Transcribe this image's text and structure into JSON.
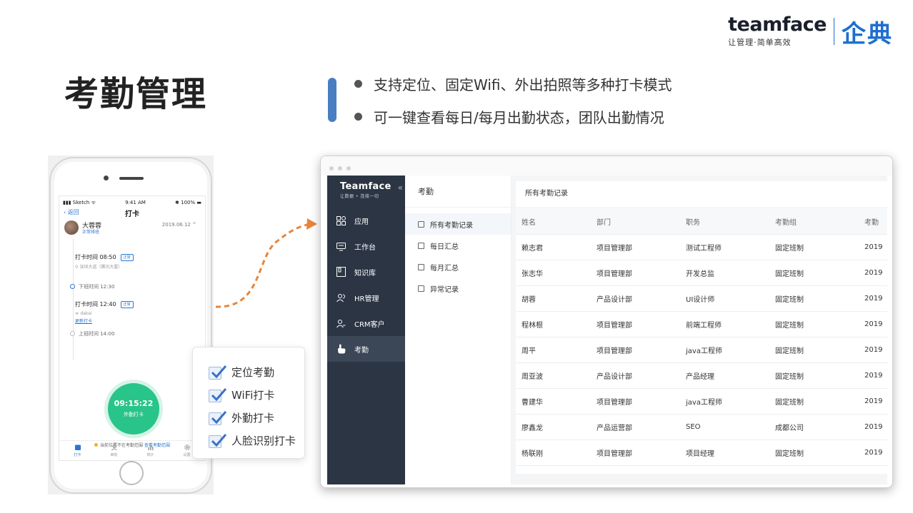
{
  "brand": {
    "word": "teamface",
    "tagline": "让管理·简单高效",
    "cn": "企典"
  },
  "slide": {
    "title": "考勤管理",
    "bullets": [
      "支持定位、固定Wifi、外出拍照等多种打卡模式",
      "可一键查看每日/每月出勤状态，团队出勤情况"
    ]
  },
  "phone": {
    "status": {
      "carrier": "Sketch",
      "time": "9:41 AM",
      "battery": "100%"
    },
    "nav": {
      "back": "返回",
      "title": "打卡"
    },
    "user": {
      "name": "大蓉蓉",
      "subtitle": "正常排班",
      "date": "2019.06.12"
    },
    "records": [
      {
        "time": "打卡时间 08:50",
        "badge": "正常",
        "sub": "深圳大道（腾讯大厦）"
      },
      {
        "node": "下班时间 12:30"
      },
      {
        "time": "打卡时间 12:40",
        "badge": "正常",
        "sub": "dakai",
        "link": "更新打卡"
      },
      {
        "node": "上班时间 14:00"
      }
    ],
    "clock": {
      "time": "09:15:22",
      "label": "外勤打卡"
    },
    "range_tip": {
      "text": "当前位置不在考勤范围",
      "link": "查看考勤范围"
    },
    "tabs": [
      "打卡",
      "审批",
      "统计",
      "设置"
    ]
  },
  "checklist": [
    "定位考勤",
    "WiFi打卡",
    "外勤打卡",
    "人脸识别打卡"
  ],
  "colors": {
    "accent": "#4a7ec2",
    "brand_blue": "#1e6fd0",
    "clock_green": "#29c48a",
    "sidebar": "#2b3544",
    "arrow": "#e8843a"
  },
  "app": {
    "logo": {
      "word": "Teamface",
      "tagline": "让数据 • 连接一切"
    },
    "sidebar": [
      "应用",
      "工作台",
      "知识库",
      "HR管理",
      "CRM客户",
      "考勤"
    ],
    "submenu": {
      "title": "考勤",
      "items": [
        "所有考勤记录",
        "每日汇总",
        "每月汇总",
        "异常记录"
      ]
    },
    "main_title": "所有考勤记录",
    "table": {
      "headers": [
        "姓名",
        "部门",
        "职务",
        "考勤组",
        "考勤"
      ],
      "rows": [
        [
          "赖志君",
          "项目管理部",
          "测试工程师",
          "固定班制",
          "2019"
        ],
        [
          "张志华",
          "项目管理部",
          "开发总监",
          "固定班制",
          "2019"
        ],
        [
          "胡蓉",
          "产品设计部",
          "UI设计师",
          "固定班制",
          "2019"
        ],
        [
          "程林根",
          "项目管理部",
          "前端工程师",
          "固定班制",
          "2019"
        ],
        [
          "周平",
          "项目管理部",
          "java工程师",
          "固定班制",
          "2019"
        ],
        [
          "周亚波",
          "产品设计部",
          "产品经理",
          "固定班制",
          "2019"
        ],
        [
          "曹建华",
          "项目管理部",
          "java工程师",
          "固定班制",
          "2019"
        ],
        [
          "廖鑫龙",
          "产品运营部",
          "SEO",
          "成都公司",
          "2019"
        ],
        [
          "杨联刚",
          "项目管理部",
          "项目经理",
          "固定班制",
          "2019"
        ]
      ]
    }
  }
}
